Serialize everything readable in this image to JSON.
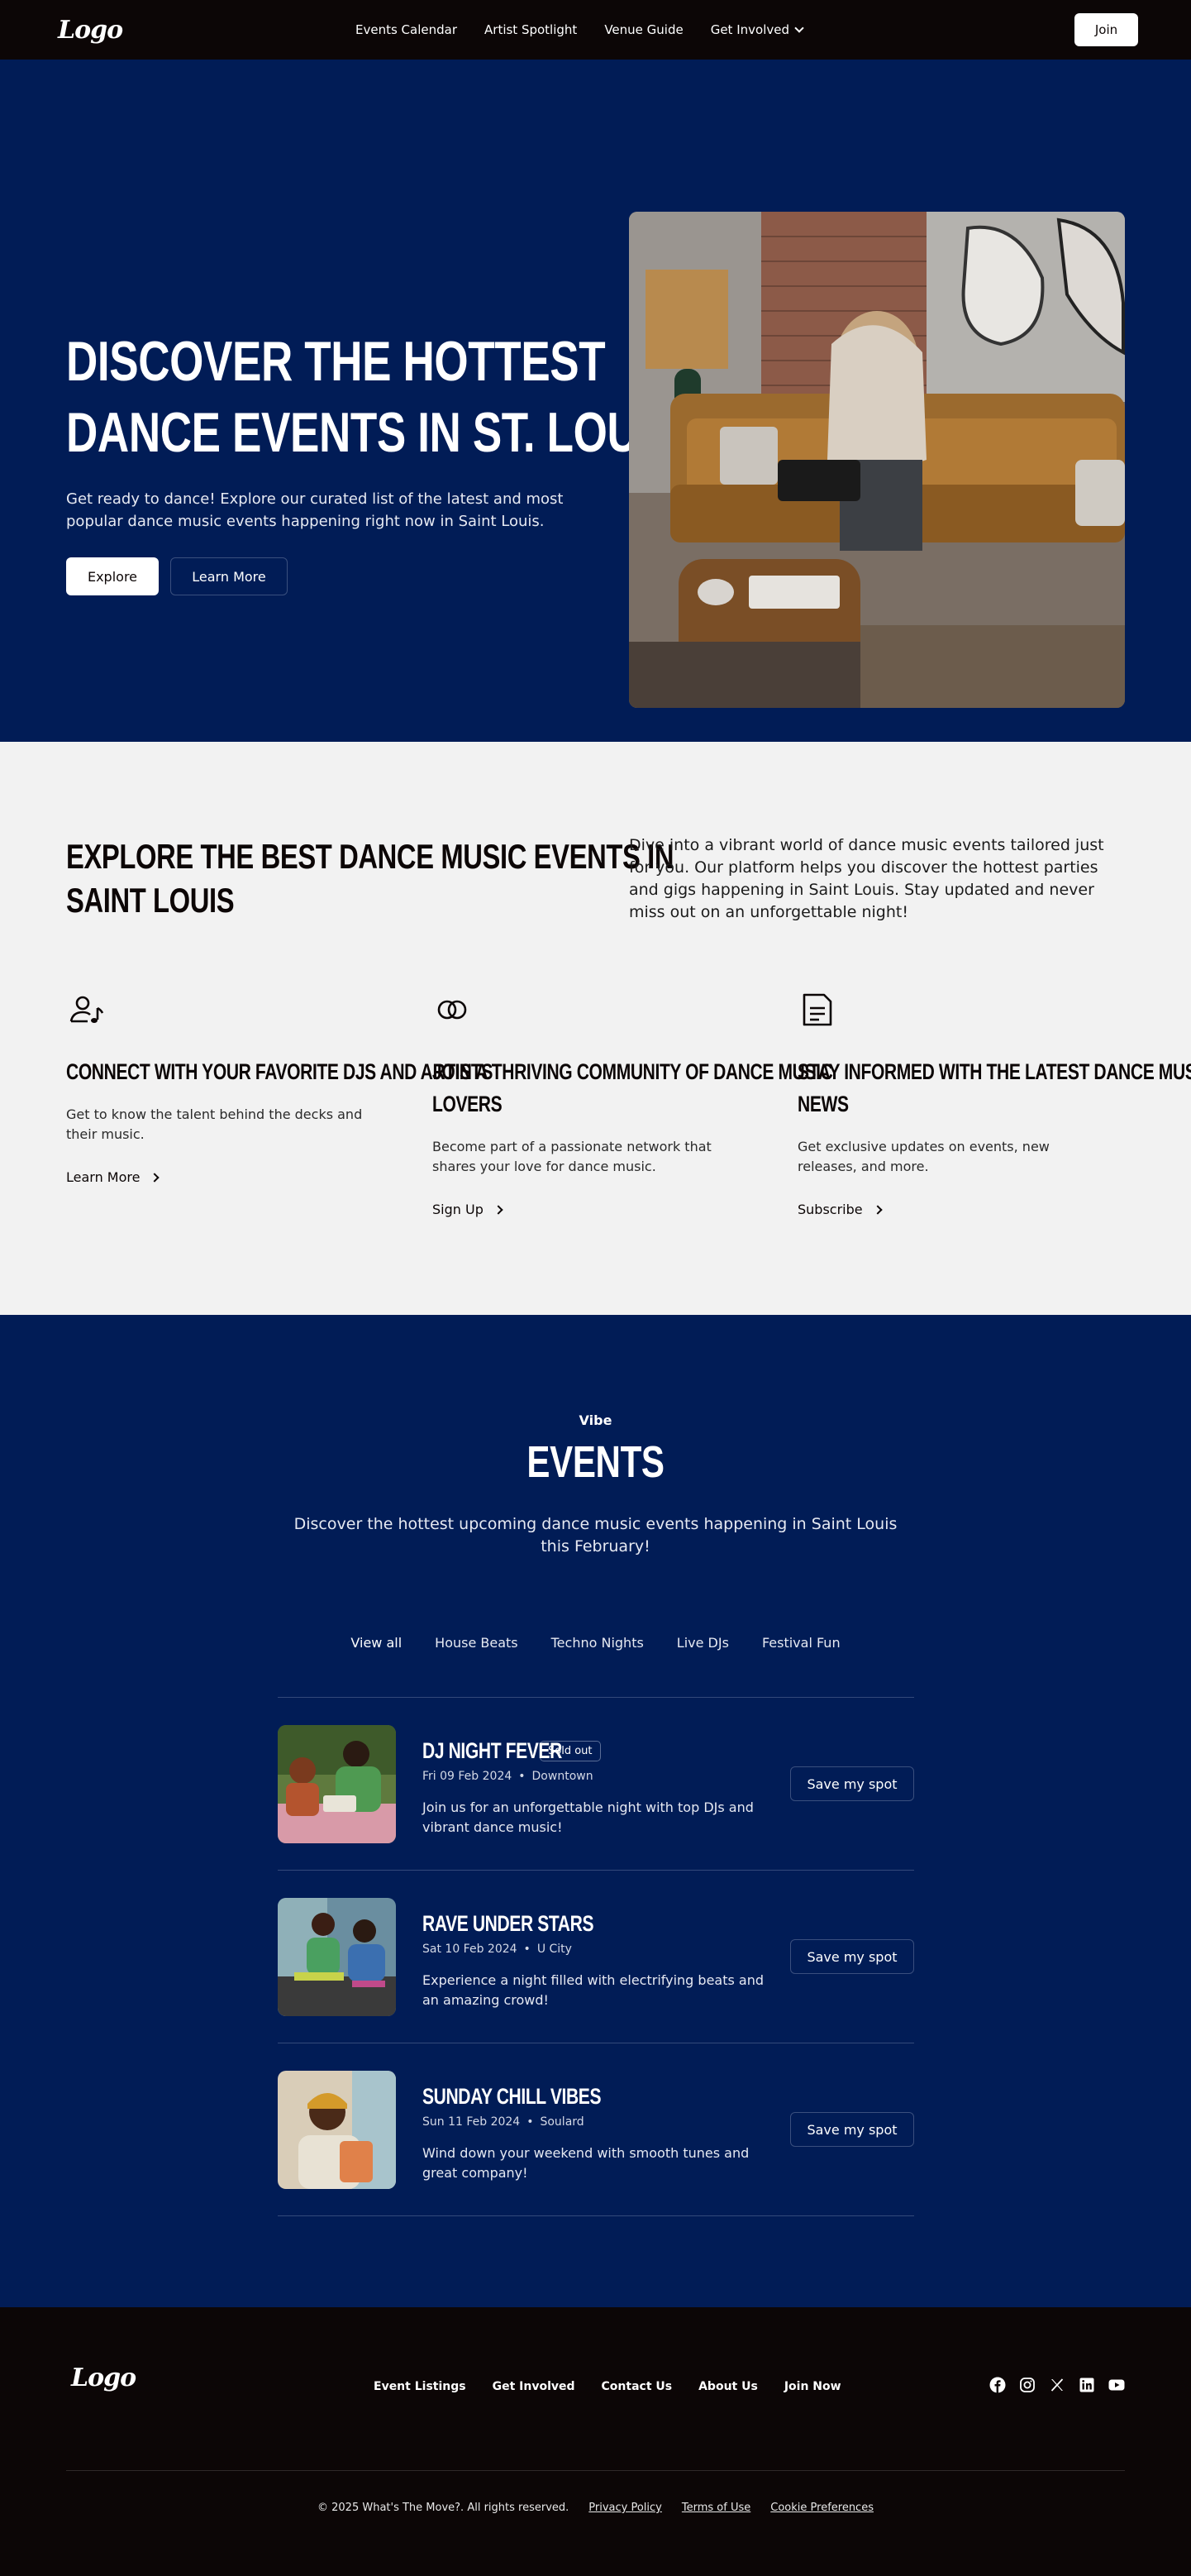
{
  "nav": {
    "logo": "Logo",
    "links": [
      "Events Calendar",
      "Artist Spotlight",
      "Venue Guide",
      "Get Involved"
    ],
    "join_label": "Join"
  },
  "hero": {
    "title_lines": [
      "Discover the Hottest",
      "Dance Events in St. Louis"
    ],
    "text": "Get ready to dance! Explore our curated list of the latest and most popular dance music events happening right now in Saint Louis.",
    "primary_label": "Explore",
    "secondary_label": "Learn More"
  },
  "explore": {
    "title_lines": [
      "Explore the Best Dance Music Events in",
      "Saint Louis"
    ],
    "text": "Dive into a vibrant world of dance music events tailored just for you. Our platform helps you discover the hottest parties and gigs happening in Saint Louis. Stay updated and never miss out on an unforgettable night!",
    "features": [
      {
        "icon": "dj-user-icon",
        "title_lines": [
          "Connect with your favorite DJs and artists"
        ],
        "text": "Get to know the talent behind the decks and their music.",
        "link": "Learn More"
      },
      {
        "icon": "rings-icon",
        "title_lines": [
          "Join a thriving community of dance music",
          "lovers"
        ],
        "text": "Become part of a passionate network that shares your love for dance music.",
        "link": "Sign Up"
      },
      {
        "icon": "newspaper-icon",
        "title_lines": [
          "Stay informed with the latest dance music",
          "news"
        ],
        "text": "Get exclusive updates on events, new releases, and more.",
        "link": "Subscribe"
      }
    ]
  },
  "events": {
    "tagline": "Vibe",
    "title": "Events",
    "subtitle": "Discover the hottest upcoming dance music events happening in Saint Louis this February!",
    "tabs": [
      "View all",
      "House Beats",
      "Techno Nights",
      "Live DJs",
      "Festival Fun"
    ],
    "items": [
      {
        "name": "DJ Night Fever",
        "badge": "Sold out",
        "date": "Fri 09 Feb 2024",
        "location": "Downtown",
        "desc": "Join us for an unforgettable night with top DJs and vibrant dance music!",
        "button": "Save my spot"
      },
      {
        "name": "Rave Under Stars",
        "badge": "",
        "date": "Sat 10 Feb 2024",
        "location": "U City",
        "desc": "Experience a night filled with electrifying beats and an amazing crowd!",
        "button": "Save my spot"
      },
      {
        "name": "Sunday Chill Vibes",
        "badge": "",
        "date": "Sun 11 Feb 2024",
        "location": "Soulard",
        "desc": "Wind down your weekend with smooth tunes and great company!",
        "button": "Save my spot"
      }
    ]
  },
  "footer": {
    "logo": "Logo",
    "links": [
      "Event Listings",
      "Get Involved",
      "Contact Us",
      "About Us",
      "Join Now"
    ],
    "socials": [
      "facebook-icon",
      "instagram-icon",
      "x-icon",
      "linkedin-icon",
      "youtube-icon"
    ],
    "copyright": "© 2025 What's The Move?. All rights reserved.",
    "legal": [
      "Privacy Policy",
      "Terms of Use",
      "Cookie Preferences"
    ]
  }
}
